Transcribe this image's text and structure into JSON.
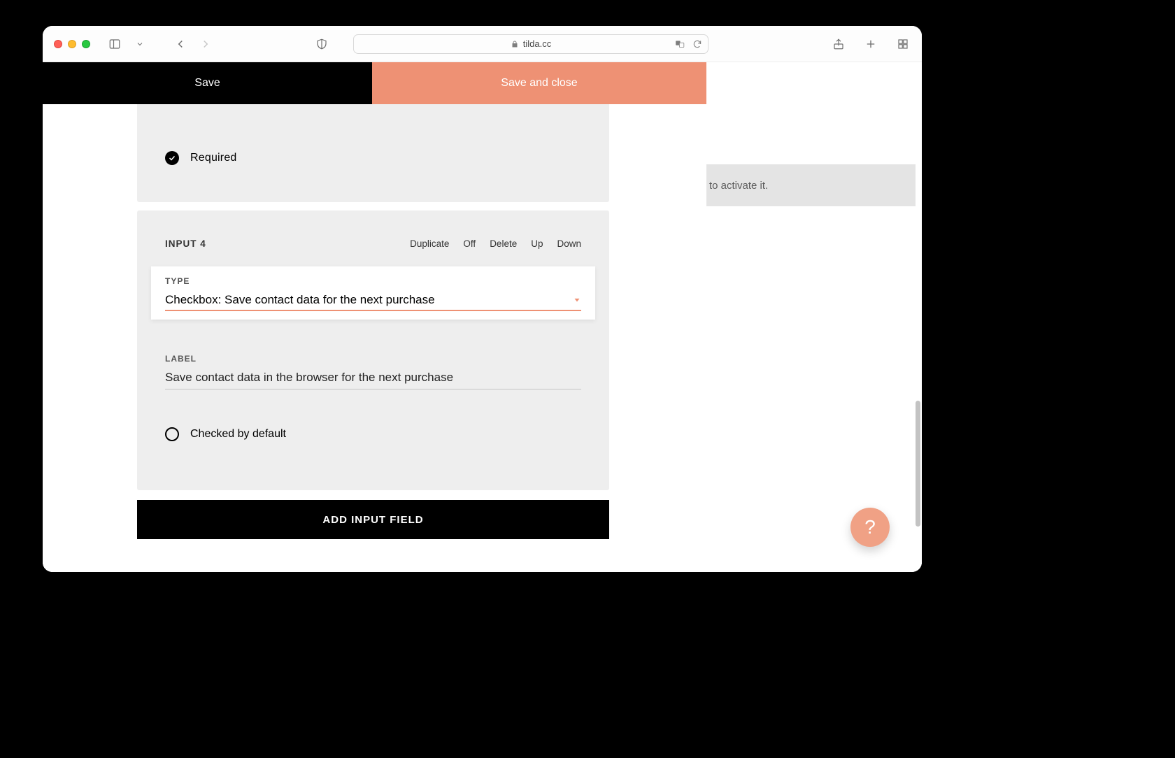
{
  "browser": {
    "domain": "tilda.cc"
  },
  "header": {
    "save_label": "Save",
    "save_close_label": "Save and close"
  },
  "top_card": {
    "required_label": "Required"
  },
  "input4": {
    "title": "INPUT 4",
    "actions": {
      "duplicate": "Duplicate",
      "off": "Off",
      "delete": "Delete",
      "up": "Up",
      "down": "Down"
    },
    "type": {
      "label": "TYPE",
      "value": "Checkbox: Save contact data for the next purchase"
    },
    "label": {
      "label": "LABEL",
      "value": "Save contact data in the browser for the next purchase"
    },
    "checked_label": "Checked by default"
  },
  "add_button_label": "ADD INPUT FIELD",
  "right_panel": {
    "hint_text": "to activate it."
  },
  "help": "?"
}
